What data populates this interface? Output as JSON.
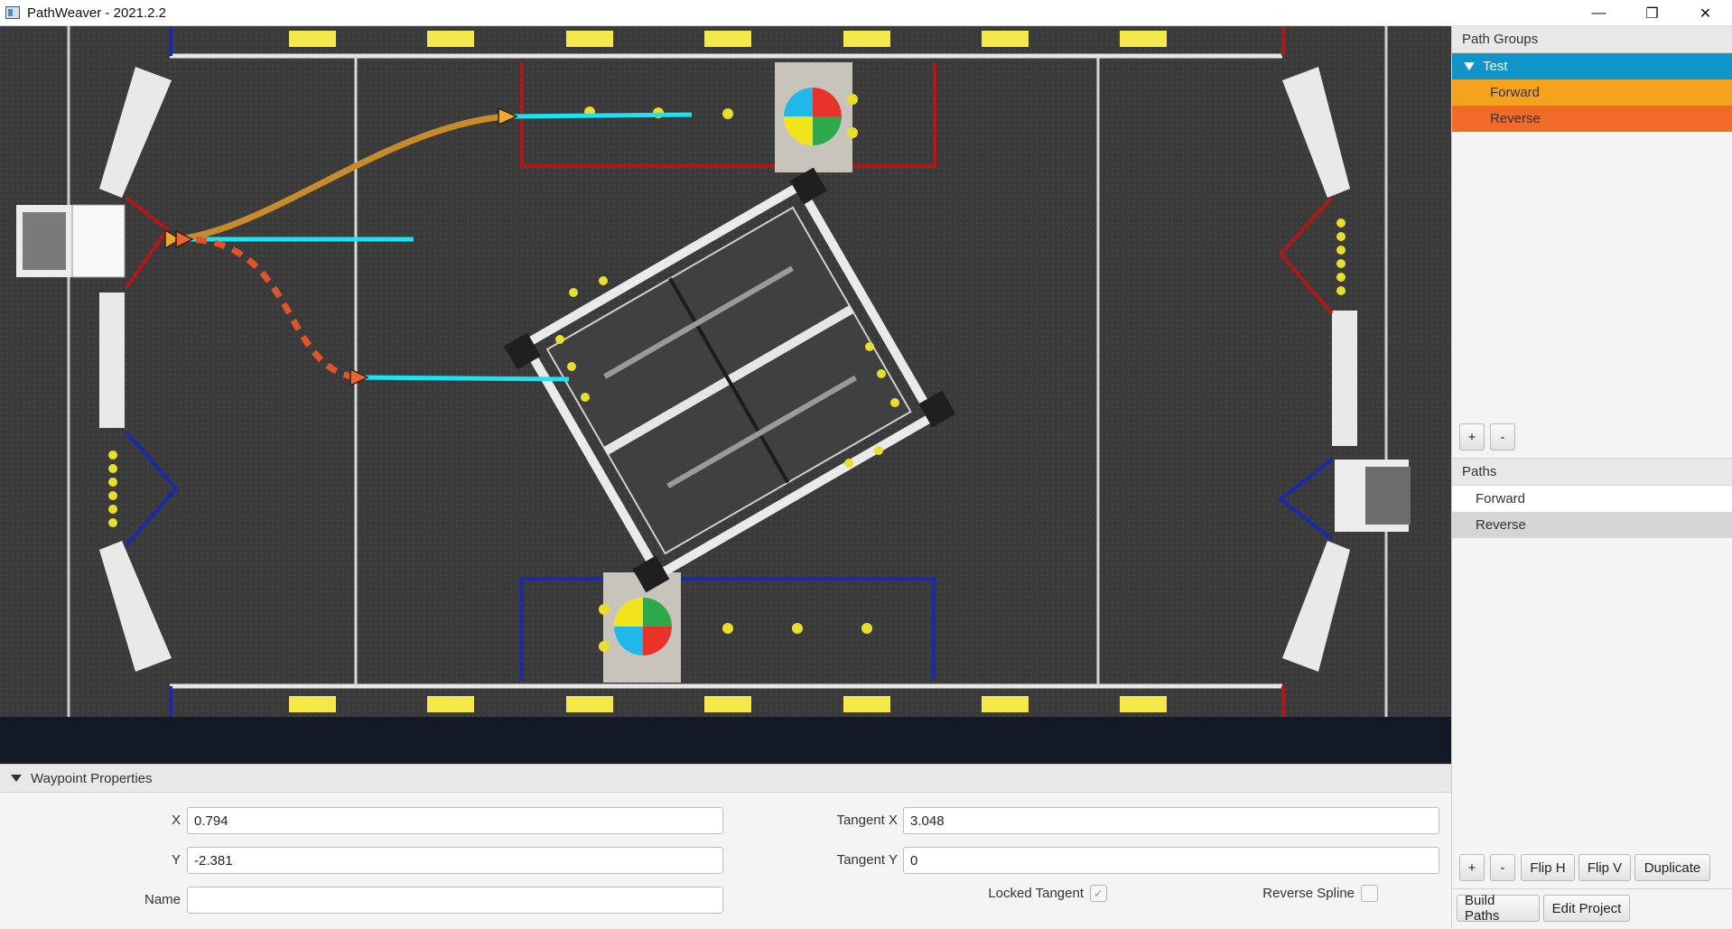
{
  "window": {
    "title": "PathWeaver - 2021.2.2",
    "minimize_glyph": "—",
    "maximize_glyph": "❐",
    "close_glyph": "✕"
  },
  "field": {
    "image": "infinite-recharge-field",
    "path_colors": {
      "forward": "#c88a2a",
      "reverse": "#e0542a",
      "tangent": "#18e4f4"
    },
    "waypoint_colors": {
      "forward": "#f4a626",
      "reverse": "#f0642c"
    }
  },
  "waypoint_properties": {
    "header": "Waypoint Properties",
    "x_label": "X",
    "x_value": "0.794",
    "y_label": "Y",
    "y_value": "-2.381",
    "name_label": "Name",
    "name_value": "",
    "tangent_x_label": "Tangent X",
    "tangent_x_value": "3.048",
    "tangent_y_label": "Tangent Y",
    "tangent_y_value": "0",
    "locked_tangent_label": "Locked Tangent",
    "locked_tangent_checked": true,
    "reverse_spline_label": "Reverse Spline",
    "reverse_spline_checked": false
  },
  "sidebar": {
    "path_groups_header": "Path Groups",
    "group_name": "Test",
    "group_items": [
      "Forward",
      "Reverse"
    ],
    "group_add": "+",
    "group_remove": "-",
    "paths_header": "Paths",
    "paths": [
      "Forward",
      "Reverse"
    ],
    "selected_path": "Reverse",
    "path_add": "+",
    "path_remove": "-",
    "flip_h": "Flip H",
    "flip_v": "Flip V",
    "duplicate": "Duplicate",
    "build_paths": "Build Paths",
    "edit_project": "Edit Project"
  }
}
